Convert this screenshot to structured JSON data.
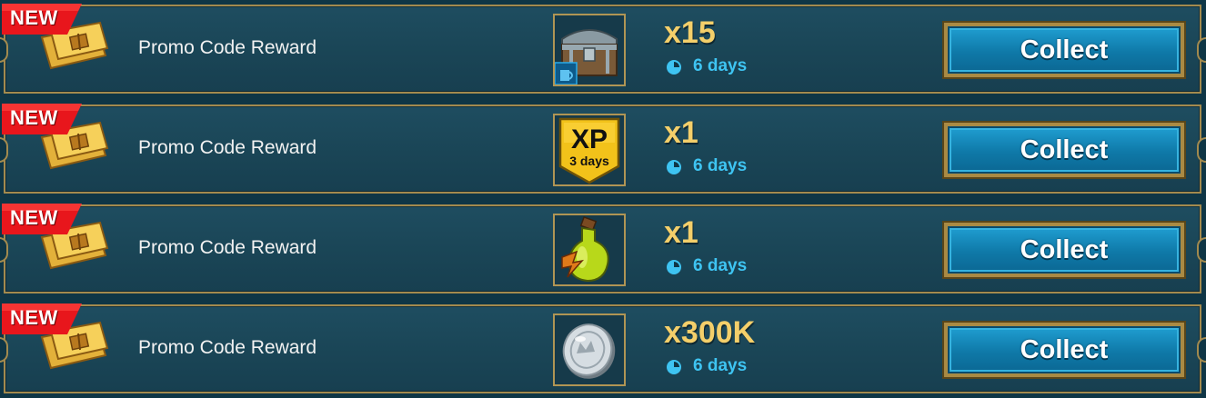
{
  "rewards": [
    {
      "badge": "NEW",
      "title": "Promo Code Reward",
      "item_icon": "chest-icon",
      "item_sub_label": "",
      "quantity": "x15",
      "timer": "6 days",
      "button": "Collect"
    },
    {
      "badge": "NEW",
      "title": "Promo Code Reward",
      "item_icon": "xp-boost-icon",
      "item_label": "XP",
      "item_sub_label": "3 days",
      "quantity": "x1",
      "timer": "6 days",
      "button": "Collect"
    },
    {
      "badge": "NEW",
      "title": "Promo Code Reward",
      "item_icon": "energy-potion-icon",
      "item_sub_label": "",
      "quantity": "x1",
      "timer": "6 days",
      "button": "Collect"
    },
    {
      "badge": "NEW",
      "title": "Promo Code Reward",
      "item_icon": "silver-coin-icon",
      "item_sub_label": "",
      "quantity": "x300K",
      "timer": "6 days",
      "button": "Collect"
    }
  ],
  "colors": {
    "background": "#0f3646",
    "row": "#1a4556",
    "gold_border": "#a38a4e",
    "quantity": "#f4cf6a",
    "timer": "#3ec4f2",
    "badge_red": "#e8161c",
    "button_blue": "#1592c6"
  }
}
